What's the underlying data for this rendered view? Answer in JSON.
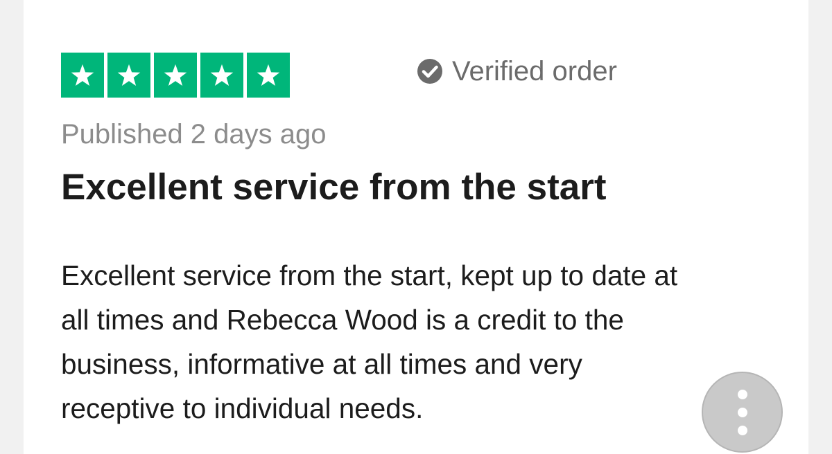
{
  "review": {
    "rating": 5,
    "max_rating": 5,
    "star_color": "#00b67a",
    "verified_label": "Verified order",
    "published": "Published 2 days ago",
    "title": "Excellent service from the start",
    "body_lines": [
      "Excellent service from the start, kept up to date at",
      "all times and Rebecca Wood is a credit to the",
      "business, informative at all times and very",
      "receptive to individual needs."
    ]
  },
  "icons": {
    "star": "star-icon",
    "verified": "check-circle-icon",
    "more": "more-vertical-icon"
  }
}
